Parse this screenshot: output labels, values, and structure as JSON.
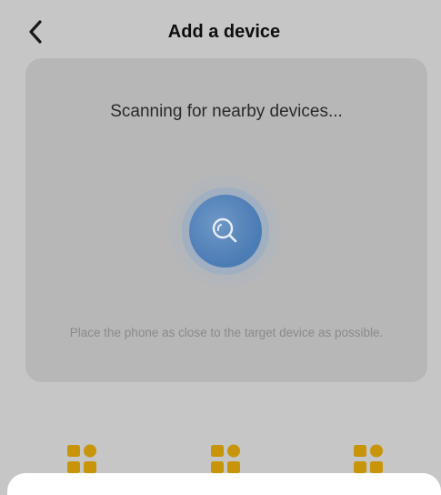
{
  "header": {
    "title": "Add a device",
    "back_icon": "chevron-left-icon"
  },
  "scan": {
    "title": "Scanning for nearby devices...",
    "hint": "Place the phone as close to the target device as possible.",
    "icon": "search-icon"
  },
  "categories": [
    {
      "icon": "device-category-icon"
    },
    {
      "icon": "device-category-icon"
    },
    {
      "icon": "device-category-icon"
    }
  ],
  "colors": {
    "overlay": "#c6c6c6",
    "card": "#b7b7b7",
    "accent_blue": "#4a7bb4",
    "category_gold": "#c8950a",
    "sheet": "#ffffff"
  }
}
